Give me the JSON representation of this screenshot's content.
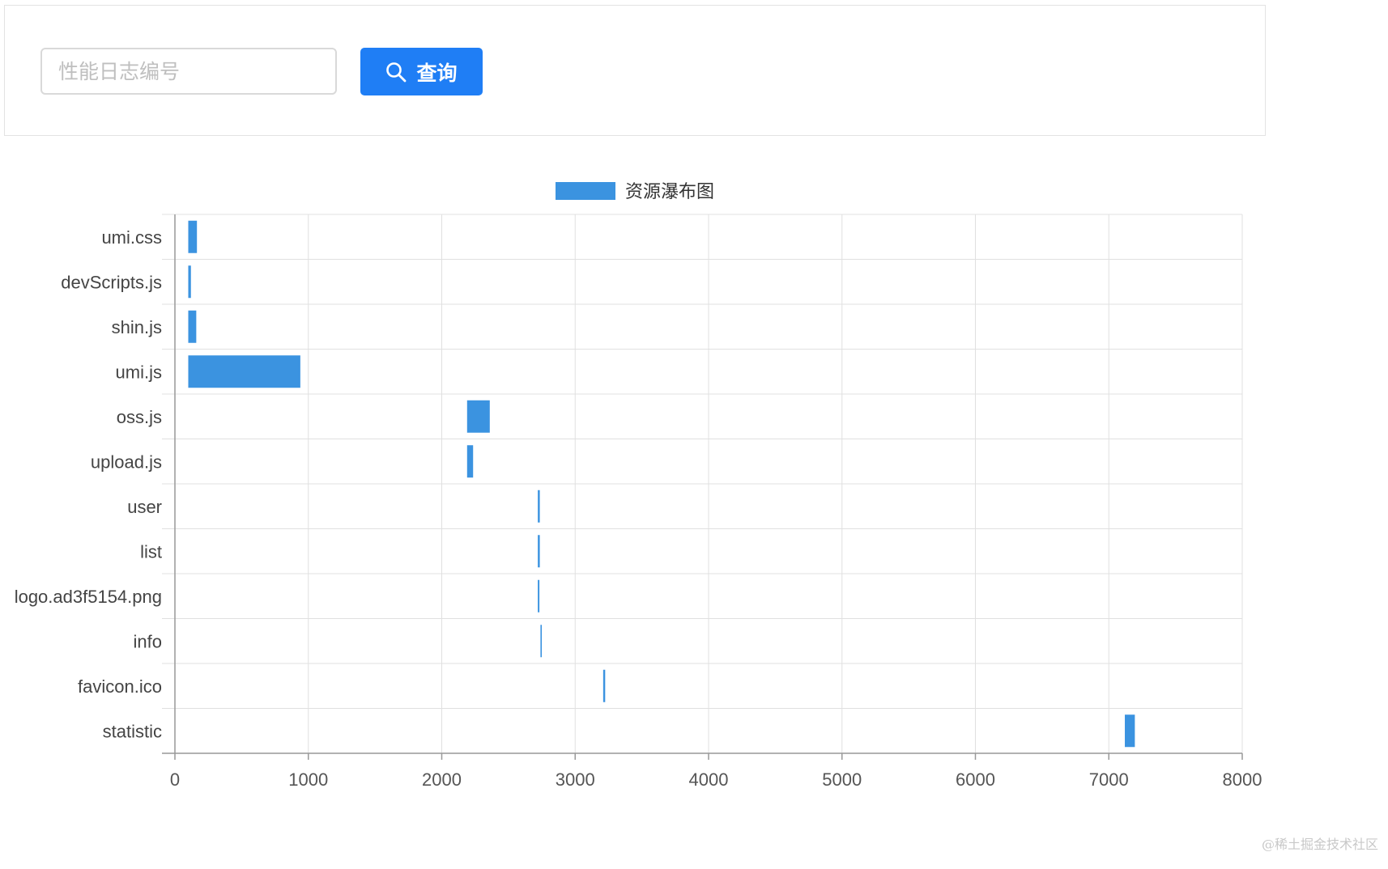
{
  "search": {
    "placeholder": "性能日志编号",
    "button_label": "查询",
    "button_icon": "search-icon"
  },
  "watermark": "@稀土掘金技术社区",
  "colors": {
    "accent": "#1f7ef5",
    "bar": "#3b93e0"
  },
  "chart_data": {
    "type": "bar",
    "orientation": "horizontal",
    "subtype": "waterfall",
    "legend": {
      "label": "资源瀑布图",
      "placement": "top-center"
    },
    "categories": [
      "umi.css",
      "devScripts.js",
      "shin.js",
      "umi.js",
      "oss.js",
      "upload.js",
      "user",
      "list",
      "logo.ad3f5154.png",
      "info",
      "favicon.ico",
      "statistic"
    ],
    "series": [
      {
        "name": "资源瀑布图",
        "start": [
          100,
          100,
          100,
          100,
          2190,
          2190,
          2720,
          2720,
          2720,
          2740,
          3210,
          7120
        ],
        "end": [
          165,
          120,
          160,
          940,
          2360,
          2235,
          2735,
          2735,
          2732,
          2750,
          3225,
          7195
        ]
      }
    ],
    "xlim": [
      0,
      8000
    ],
    "xticks": [
      "0",
      "1000",
      "2000",
      "3000",
      "4000",
      "5000",
      "6000",
      "7000",
      "8000"
    ],
    "grid": true
  }
}
